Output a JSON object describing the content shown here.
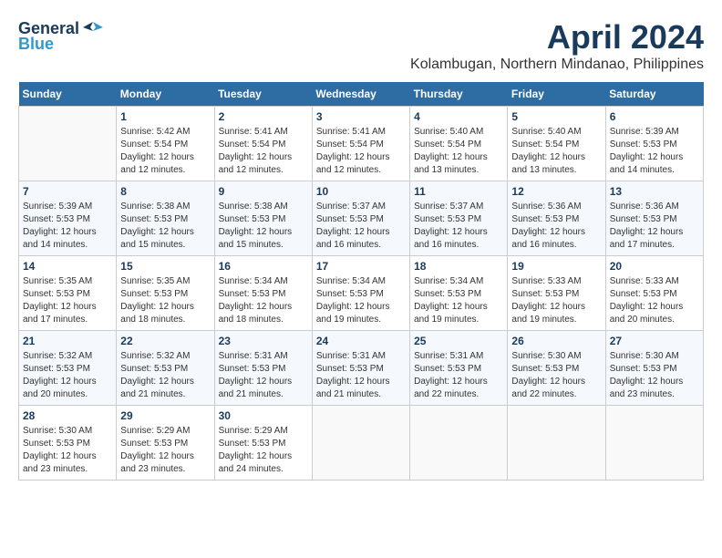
{
  "header": {
    "logo": {
      "general": "General",
      "blue": "Blue"
    },
    "title": "April 2024",
    "subtitle": "Kolambugan, Northern Mindanao, Philippines"
  },
  "weekdays": [
    "Sunday",
    "Monday",
    "Tuesday",
    "Wednesday",
    "Thursday",
    "Friday",
    "Saturday"
  ],
  "weeks": [
    [
      {
        "day": "",
        "empty": true
      },
      {
        "day": "1",
        "sunrise": "5:42 AM",
        "sunset": "5:54 PM",
        "daylight": "12 hours and 12 minutes."
      },
      {
        "day": "2",
        "sunrise": "5:41 AM",
        "sunset": "5:54 PM",
        "daylight": "12 hours and 12 minutes."
      },
      {
        "day": "3",
        "sunrise": "5:41 AM",
        "sunset": "5:54 PM",
        "daylight": "12 hours and 12 minutes."
      },
      {
        "day": "4",
        "sunrise": "5:40 AM",
        "sunset": "5:54 PM",
        "daylight": "12 hours and 13 minutes."
      },
      {
        "day": "5",
        "sunrise": "5:40 AM",
        "sunset": "5:54 PM",
        "daylight": "12 hours and 13 minutes."
      },
      {
        "day": "6",
        "sunrise": "5:39 AM",
        "sunset": "5:53 PM",
        "daylight": "12 hours and 14 minutes."
      }
    ],
    [
      {
        "day": "7",
        "sunrise": "5:39 AM",
        "sunset": "5:53 PM",
        "daylight": "12 hours and 14 minutes."
      },
      {
        "day": "8",
        "sunrise": "5:38 AM",
        "sunset": "5:53 PM",
        "daylight": "12 hours and 15 minutes."
      },
      {
        "day": "9",
        "sunrise": "5:38 AM",
        "sunset": "5:53 PM",
        "daylight": "12 hours and 15 minutes."
      },
      {
        "day": "10",
        "sunrise": "5:37 AM",
        "sunset": "5:53 PM",
        "daylight": "12 hours and 16 minutes."
      },
      {
        "day": "11",
        "sunrise": "5:37 AM",
        "sunset": "5:53 PM",
        "daylight": "12 hours and 16 minutes."
      },
      {
        "day": "12",
        "sunrise": "5:36 AM",
        "sunset": "5:53 PM",
        "daylight": "12 hours and 16 minutes."
      },
      {
        "day": "13",
        "sunrise": "5:36 AM",
        "sunset": "5:53 PM",
        "daylight": "12 hours and 17 minutes."
      }
    ],
    [
      {
        "day": "14",
        "sunrise": "5:35 AM",
        "sunset": "5:53 PM",
        "daylight": "12 hours and 17 minutes."
      },
      {
        "day": "15",
        "sunrise": "5:35 AM",
        "sunset": "5:53 PM",
        "daylight": "12 hours and 18 minutes."
      },
      {
        "day": "16",
        "sunrise": "5:34 AM",
        "sunset": "5:53 PM",
        "daylight": "12 hours and 18 minutes."
      },
      {
        "day": "17",
        "sunrise": "5:34 AM",
        "sunset": "5:53 PM",
        "daylight": "12 hours and 19 minutes."
      },
      {
        "day": "18",
        "sunrise": "5:34 AM",
        "sunset": "5:53 PM",
        "daylight": "12 hours and 19 minutes."
      },
      {
        "day": "19",
        "sunrise": "5:33 AM",
        "sunset": "5:53 PM",
        "daylight": "12 hours and 19 minutes."
      },
      {
        "day": "20",
        "sunrise": "5:33 AM",
        "sunset": "5:53 PM",
        "daylight": "12 hours and 20 minutes."
      }
    ],
    [
      {
        "day": "21",
        "sunrise": "5:32 AM",
        "sunset": "5:53 PM",
        "daylight": "12 hours and 20 minutes."
      },
      {
        "day": "22",
        "sunrise": "5:32 AM",
        "sunset": "5:53 PM",
        "daylight": "12 hours and 21 minutes."
      },
      {
        "day": "23",
        "sunrise": "5:31 AM",
        "sunset": "5:53 PM",
        "daylight": "12 hours and 21 minutes."
      },
      {
        "day": "24",
        "sunrise": "5:31 AM",
        "sunset": "5:53 PM",
        "daylight": "12 hours and 21 minutes."
      },
      {
        "day": "25",
        "sunrise": "5:31 AM",
        "sunset": "5:53 PM",
        "daylight": "12 hours and 22 minutes."
      },
      {
        "day": "26",
        "sunrise": "5:30 AM",
        "sunset": "5:53 PM",
        "daylight": "12 hours and 22 minutes."
      },
      {
        "day": "27",
        "sunrise": "5:30 AM",
        "sunset": "5:53 PM",
        "daylight": "12 hours and 23 minutes."
      }
    ],
    [
      {
        "day": "28",
        "sunrise": "5:30 AM",
        "sunset": "5:53 PM",
        "daylight": "12 hours and 23 minutes."
      },
      {
        "day": "29",
        "sunrise": "5:29 AM",
        "sunset": "5:53 PM",
        "daylight": "12 hours and 23 minutes."
      },
      {
        "day": "30",
        "sunrise": "5:29 AM",
        "sunset": "5:53 PM",
        "daylight": "12 hours and 24 minutes."
      },
      {
        "day": "",
        "empty": true
      },
      {
        "day": "",
        "empty": true
      },
      {
        "day": "",
        "empty": true
      },
      {
        "day": "",
        "empty": true
      }
    ]
  ],
  "labels": {
    "sunrise": "Sunrise:",
    "sunset": "Sunset:",
    "daylight": "Daylight:"
  }
}
